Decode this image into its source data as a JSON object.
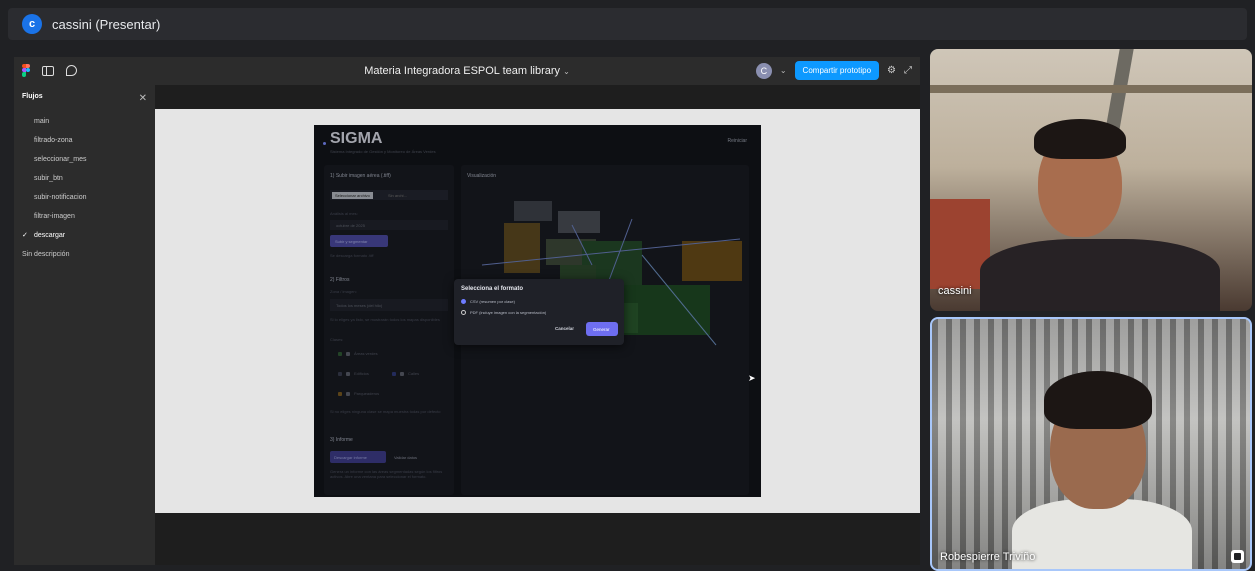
{
  "meet": {
    "presenter_initial": "c",
    "presenter_title": "cassini (Presentar)",
    "participants": [
      {
        "name": "cassini"
      },
      {
        "name": "Robespierre Triviño"
      }
    ]
  },
  "figma": {
    "file_title": "Materia Integradora ESPOL team library",
    "user_initial": "C",
    "share_label": "Compartir prototipo",
    "flows": {
      "heading": "Flujos",
      "items": [
        "main",
        "filtrado-zona",
        "seleccionar_mes",
        "subir_btn",
        "subir-notificacion",
        "filtrar-imagen",
        "descargar"
      ],
      "active": "descargar",
      "description": "Sin descripción"
    }
  },
  "prototype": {
    "title": "SIGMA",
    "subtitle": "Sistema Integrado de Gestión y Monitoreo de Áreas Verdes",
    "reset": "Reiniciar",
    "upload_title": "1) Subir imagen aérea (.tiff)",
    "file_button": "Seleccionar archivo",
    "file_status": "Sin archi...",
    "month_label": "Análisis al mes:",
    "month_value": "octubre de 2025",
    "upload_button": "Subir y segmentar",
    "format_hint": "Se descarga formato .tiff",
    "filters_title": "2) Filtros",
    "zone_label": "Zona / imagen:",
    "zone_value": "Todos los meses (del hilo)",
    "zone_hint": "Si lo eliges ya listo, se mostrarán todos los mapas disponibles",
    "classes_label": "Clases:",
    "classes": [
      "Áreas verdes",
      "Edificios",
      "Calles",
      "Parqueaderos"
    ],
    "classes_hint": "Si no eliges ninguna clase se mapa muestra todas por defecto",
    "report_title": "3) Informe",
    "report_button": "Descargar informe",
    "validate_button": "Validar datos",
    "report_hint": "Genera un informe con las áreas segmentadas según los filtros activos. Abre una ventana para seleccionar el formato.",
    "viz_title": "Visualización",
    "modal": {
      "title": "Selecciona el formato",
      "options": [
        "CSV (resumen por clase)",
        "PDF (incluye imagen con la segmentación)"
      ],
      "selected": 0,
      "cancel": "Cancelar",
      "generate": "Generar"
    }
  }
}
